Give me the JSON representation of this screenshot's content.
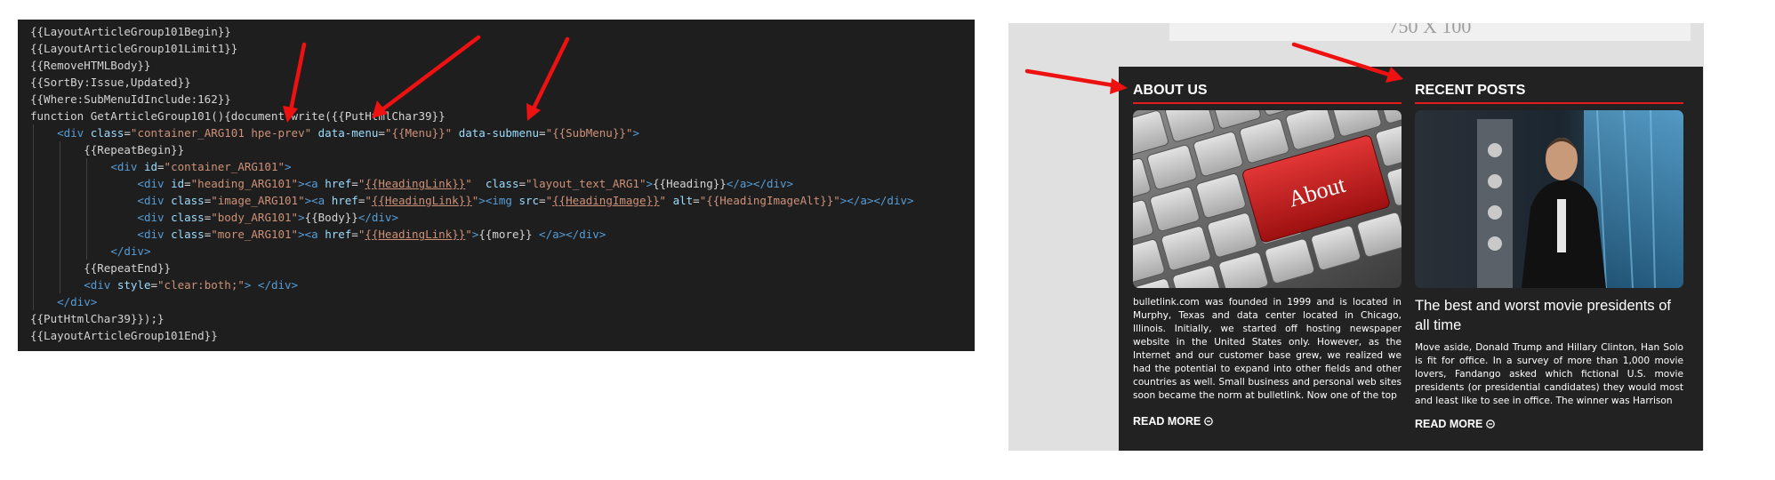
{
  "code_editor": {
    "lines": [
      [
        {
          "t": "{{LayoutArticleGroup101Begin}}",
          "c": "plain"
        }
      ],
      [
        {
          "t": "{{LayoutArticleGroup101Limit1}}",
          "c": "plain"
        }
      ],
      [
        {
          "t": "{{RemoveHTMLBody}}",
          "c": "plain"
        }
      ],
      [
        {
          "t": "{{SortBy:Issue,Updated}}",
          "c": "plain"
        }
      ],
      [
        {
          "t": "{{Where:SubMenuIdInclude:162}}",
          "c": "plain"
        }
      ],
      [
        {
          "t": "function GetArticleGroup101(){document.write({{PutHtmlChar39}}",
          "c": "plain"
        }
      ],
      [
        {
          "t": "    ",
          "c": "plain"
        },
        {
          "t": "<div ",
          "c": "tag"
        },
        {
          "t": "class",
          "c": "attr"
        },
        {
          "t": "=",
          "c": "plain"
        },
        {
          "t": "\"container_ARG101 hpe-prev\"",
          "c": "str"
        },
        {
          "t": " ",
          "c": "plain"
        },
        {
          "t": "data-menu",
          "c": "attr"
        },
        {
          "t": "=",
          "c": "plain"
        },
        {
          "t": "\"{{Menu}}\"",
          "c": "str"
        },
        {
          "t": " ",
          "c": "plain"
        },
        {
          "t": "data-submenu",
          "c": "attr"
        },
        {
          "t": "=",
          "c": "plain"
        },
        {
          "t": "\"{{SubMenu}}\"",
          "c": "str"
        },
        {
          "t": ">",
          "c": "tag"
        }
      ],
      [
        {
          "t": "        {{RepeatBegin}}",
          "c": "plain"
        }
      ],
      [
        {
          "t": "            ",
          "c": "plain"
        },
        {
          "t": "<div ",
          "c": "tag"
        },
        {
          "t": "id",
          "c": "attr"
        },
        {
          "t": "=",
          "c": "plain"
        },
        {
          "t": "\"container_ARG101\"",
          "c": "str"
        },
        {
          "t": ">",
          "c": "tag"
        }
      ],
      [
        {
          "t": "                ",
          "c": "plain"
        },
        {
          "t": "<div ",
          "c": "tag"
        },
        {
          "t": "id",
          "c": "attr"
        },
        {
          "t": "=",
          "c": "plain"
        },
        {
          "t": "\"heading_ARG101\"",
          "c": "str"
        },
        {
          "t": ">",
          "c": "tag"
        },
        {
          "t": "<a ",
          "c": "tag"
        },
        {
          "t": "href",
          "c": "attr"
        },
        {
          "t": "=",
          "c": "plain"
        },
        {
          "t": "\"",
          "c": "str"
        },
        {
          "t": "{{HeadingLink}}",
          "c": "link"
        },
        {
          "t": "\"",
          "c": "str"
        },
        {
          "t": "  ",
          "c": "plain"
        },
        {
          "t": "class",
          "c": "attr"
        },
        {
          "t": "=",
          "c": "plain"
        },
        {
          "t": "\"layout_text_ARG1\"",
          "c": "str"
        },
        {
          "t": ">",
          "c": "tag"
        },
        {
          "t": "{{Heading}}",
          "c": "plain"
        },
        {
          "t": "</a></div>",
          "c": "tag"
        }
      ],
      [
        {
          "t": "                ",
          "c": "plain"
        },
        {
          "t": "<div ",
          "c": "tag"
        },
        {
          "t": "class",
          "c": "attr"
        },
        {
          "t": "=",
          "c": "plain"
        },
        {
          "t": "\"image_ARG101\"",
          "c": "str"
        },
        {
          "t": ">",
          "c": "tag"
        },
        {
          "t": "<a ",
          "c": "tag"
        },
        {
          "t": "href",
          "c": "attr"
        },
        {
          "t": "=",
          "c": "plain"
        },
        {
          "t": "\"",
          "c": "str"
        },
        {
          "t": "{{HeadingLink}}",
          "c": "link"
        },
        {
          "t": "\"",
          "c": "str"
        },
        {
          "t": ">",
          "c": "tag"
        },
        {
          "t": "<img ",
          "c": "tag"
        },
        {
          "t": "src",
          "c": "attr"
        },
        {
          "t": "=",
          "c": "plain"
        },
        {
          "t": "\"",
          "c": "str"
        },
        {
          "t": "{{HeadingImage}}",
          "c": "link"
        },
        {
          "t": "\"",
          "c": "str"
        },
        {
          "t": " ",
          "c": "plain"
        },
        {
          "t": "alt",
          "c": "attr"
        },
        {
          "t": "=",
          "c": "plain"
        },
        {
          "t": "\"{{HeadingImageAlt}}\"",
          "c": "str"
        },
        {
          "t": "></a></div>",
          "c": "tag"
        }
      ],
      [
        {
          "t": "                ",
          "c": "plain"
        },
        {
          "t": "<div ",
          "c": "tag"
        },
        {
          "t": "class",
          "c": "attr"
        },
        {
          "t": "=",
          "c": "plain"
        },
        {
          "t": "\"body_ARG101\"",
          "c": "str"
        },
        {
          "t": ">",
          "c": "tag"
        },
        {
          "t": "{{Body}}",
          "c": "plain"
        },
        {
          "t": "</div>",
          "c": "tag"
        }
      ],
      [
        {
          "t": "                ",
          "c": "plain"
        },
        {
          "t": "<div ",
          "c": "tag"
        },
        {
          "t": "class",
          "c": "attr"
        },
        {
          "t": "=",
          "c": "plain"
        },
        {
          "t": "\"more_ARG101\"",
          "c": "str"
        },
        {
          "t": ">",
          "c": "tag"
        },
        {
          "t": "<a ",
          "c": "tag"
        },
        {
          "t": "href",
          "c": "attr"
        },
        {
          "t": "=",
          "c": "plain"
        },
        {
          "t": "\"",
          "c": "str"
        },
        {
          "t": "{{HeadingLink}}",
          "c": "link"
        },
        {
          "t": "\"",
          "c": "str"
        },
        {
          "t": ">",
          "c": "tag"
        },
        {
          "t": "{{more}} ",
          "c": "plain"
        },
        {
          "t": "</a></div>",
          "c": "tag"
        }
      ],
      [
        {
          "t": "            ",
          "c": "plain"
        },
        {
          "t": "</div>",
          "c": "tag"
        }
      ],
      [
        {
          "t": "        {{RepeatEnd}}",
          "c": "plain"
        }
      ],
      [
        {
          "t": "        ",
          "c": "plain"
        },
        {
          "t": "<div ",
          "c": "tag"
        },
        {
          "t": "style",
          "c": "attr"
        },
        {
          "t": "=",
          "c": "plain"
        },
        {
          "t": "\"clear:both;\"",
          "c": "str"
        },
        {
          "t": "> </div>",
          "c": "tag"
        }
      ],
      [
        {
          "t": "    ",
          "c": "plain"
        },
        {
          "t": "</div>",
          "c": "tag"
        }
      ],
      [
        {
          "t": "{{PutHtmlChar39}});}",
          "c": "plain"
        }
      ],
      [
        {
          "t": "{{LayoutArticleGroup101End}}",
          "c": "plain"
        }
      ]
    ]
  },
  "preview": {
    "ad_banner_text": "750 X 100",
    "about": {
      "title": "ABOUT US",
      "image_caption": "About",
      "body": "bulletlink.com was founded in 1999 and is located in Murphy, Texas and data center located in Chicago, Illinois. Initially, we started off hosting newspaper website in the United States only. However, as the Internet and our customer base grew, we realized we had the potential to expand into other fields and other countries as well. Small business and personal web sites soon became the norm at bulletlink. Now one of the top",
      "read_more": "READ MORE"
    },
    "recent": {
      "title": "RECENT POSTS",
      "heading": "The best and worst movie presidents of all time",
      "body": "Move aside, Donald Trump and Hillary Clinton, Han Solo is fit for office. In a survey of more than 1,000 movie lovers, Fandango asked which fictional U.S. movie presidents (or presidential candidates) they would most and least like to see in office. The winner was Harrison",
      "read_more": "READ MORE"
    },
    "colors": {
      "accent_red": "#e21b1b",
      "panel_bg": "#222222",
      "arrow_red": "#ee1111"
    }
  }
}
